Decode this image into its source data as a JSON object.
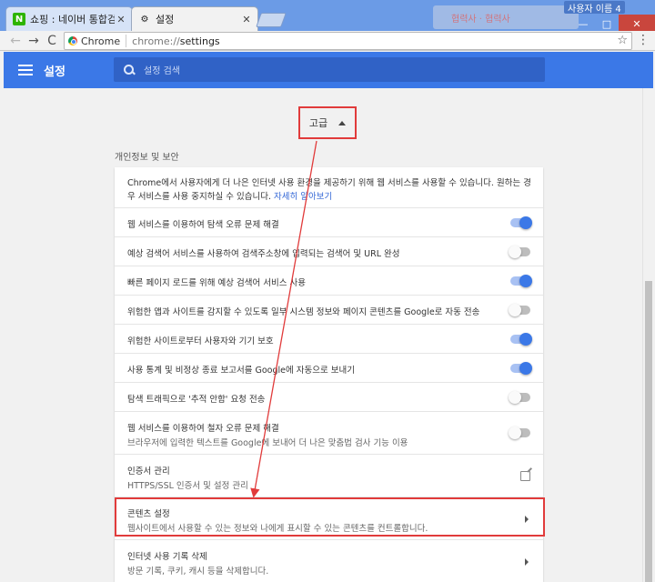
{
  "browser": {
    "tabs": [
      {
        "title": "쇼핑 : 네이버 통합검색",
        "favicon": "naver-icon",
        "active": false
      },
      {
        "title": "설정",
        "favicon": "gear-icon",
        "active": true
      }
    ],
    "background_window_text": "협력사 · 협력사",
    "profile_label": "사용자 이름 4",
    "window_controls": {
      "minimize": "—",
      "maximize": "□",
      "close": "✕"
    },
    "nav": {
      "back": "←",
      "forward": "→",
      "reload": "C"
    },
    "omnibox": {
      "badge": "Chrome",
      "scheme": "chrome://",
      "path": "settings"
    },
    "bookmark_star": "☆",
    "menu": "⋮"
  },
  "header": {
    "title": "설정",
    "search_placeholder": "설정 검색",
    "accent_color": "#3b78e7"
  },
  "advanced": {
    "label": "고급"
  },
  "section": {
    "title": "개인정보 및 보안",
    "intro_text": "Chrome에서 사용자에게 더 나은 인터넷 사용 환경을 제공하기 위해 웹 서비스를 사용할 수 있습니다. 원하는 경우 서비스를 사용 중지하실 수 있습니다.",
    "intro_link": "자세히 알아보기",
    "rows": [
      {
        "label": "웹 서비스를 이용하여 탐색 오류 문제 해결",
        "control": "toggle",
        "state": "on"
      },
      {
        "label": "예상 검색어 서비스를 사용하여 검색주소창에 입력되는 검색어 및 URL 완성",
        "control": "toggle",
        "state": "off"
      },
      {
        "label": "빠른 페이지 로드를 위해 예상 검색어 서비스 사용",
        "control": "toggle",
        "state": "on"
      },
      {
        "label": "위험한 앱과 사이트를 감지할 수 있도록 일부 시스템 정보와 페이지 콘텐츠를 Google로 자동 전송",
        "control": "toggle",
        "state": "off"
      },
      {
        "label": "위험한 사이트로부터 사용자와 기기 보호",
        "control": "toggle",
        "state": "on"
      },
      {
        "label": "사용 통계 및 비정상 종료 보고서를 Google에 자동으로 보내기",
        "control": "toggle",
        "state": "on"
      },
      {
        "label": "탐색 트래픽으로 '추적 안함' 요청 전송",
        "control": "toggle",
        "state": "off"
      },
      {
        "label": "웹 서비스를 이용하여 철자 오류 문제 해결",
        "sub": "브라우저에 입력한 텍스트를 Google에 보내어 더 나은 맞춤법 검사 기능 이용",
        "control": "toggle",
        "state": "off"
      },
      {
        "label": "인증서 관리",
        "sub": "HTTPS/SSL 인증서 및 설정 관리",
        "control": "external-link"
      },
      {
        "label": "콘텐츠 설정",
        "sub": "웹사이트에서 사용할 수 있는 정보와 나에게 표시할 수 있는 콘텐츠를 컨트롤합니다.",
        "control": "arrow",
        "highlighted": true
      },
      {
        "label": "인터넷 사용 기록 삭제",
        "sub": "방문 기록, 쿠키, 캐시 등을 삭제합니다.",
        "control": "arrow"
      }
    ]
  },
  "annotation_color": "#e13b3b"
}
